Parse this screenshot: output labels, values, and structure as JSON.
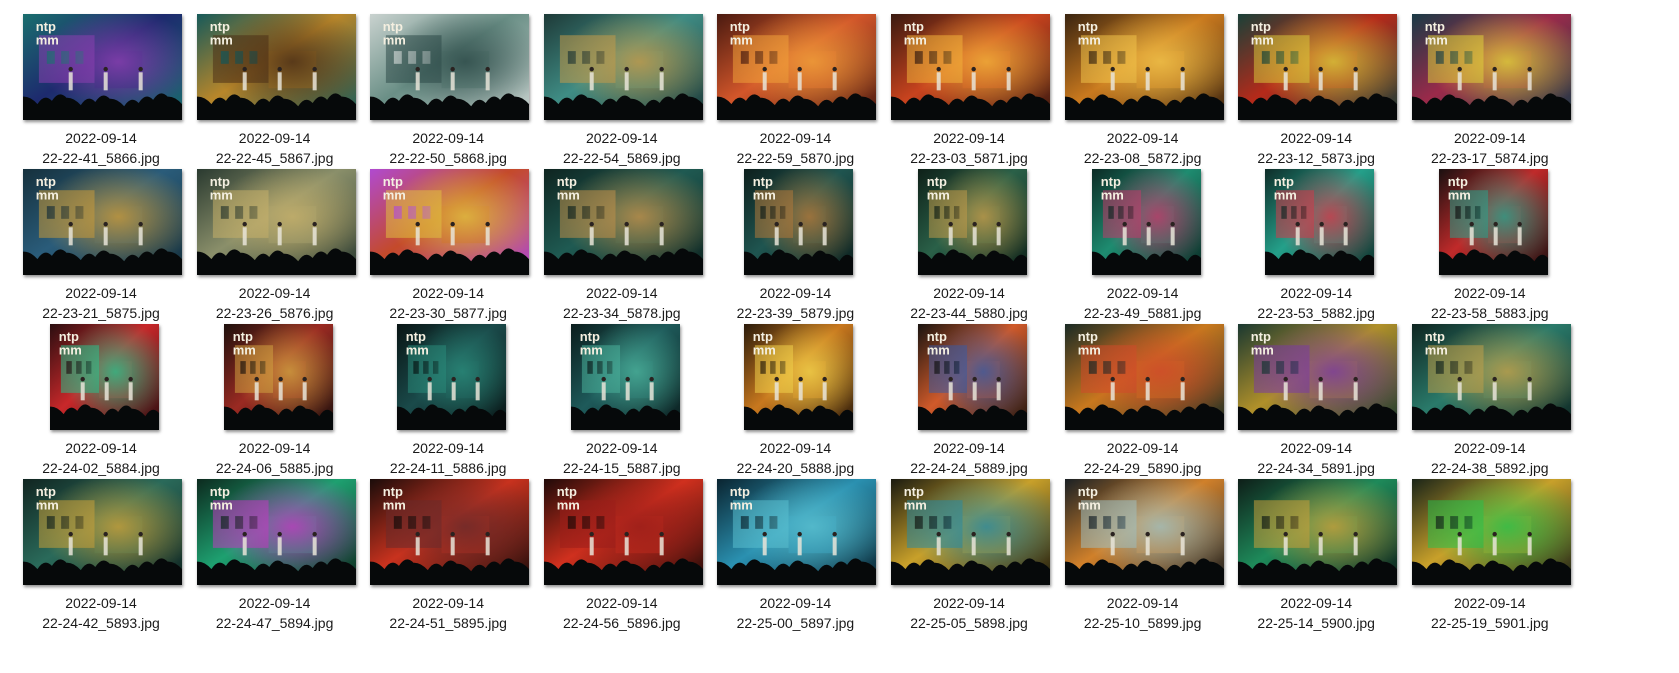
{
  "thumbnails": [
    {
      "date": "2022-09-14",
      "filename": "22-22-41_5866.jpg",
      "orientation": "landscape",
      "palette": [
        "#1d2a6e",
        "#8a3fb0",
        "#1a6e6e"
      ],
      "logo": true
    },
    {
      "date": "2022-09-14",
      "filename": "22-22-45_5867.jpg",
      "orientation": "landscape",
      "palette": [
        "#b8862a",
        "#4a2d16",
        "#175a5a"
      ],
      "logo": true
    },
    {
      "date": "2022-09-14",
      "filename": "22-22-50_5868.jpg",
      "orientation": "landscape",
      "palette": [
        "#6a8f86",
        "#2d4a48",
        "#c9d2cf"
      ],
      "logo": true
    },
    {
      "date": "2022-09-14",
      "filename": "22-22-54_5869.jpg",
      "orientation": "landscape",
      "palette": [
        "#3f8c84",
        "#c29a4a",
        "#1e3a38"
      ],
      "logo": false
    },
    {
      "date": "2022-09-14",
      "filename": "22-22-59_5870.jpg",
      "orientation": "landscape",
      "palette": [
        "#d2562a",
        "#f0a03a",
        "#4a1a10"
      ],
      "logo": true
    },
    {
      "date": "2022-09-14",
      "filename": "22-23-03_5871.jpg",
      "orientation": "landscape",
      "palette": [
        "#c8431e",
        "#f2b23a",
        "#3a1a10"
      ],
      "logo": true
    },
    {
      "date": "2022-09-14",
      "filename": "22-23-08_5872.jpg",
      "orientation": "landscape",
      "palette": [
        "#c9791e",
        "#f0c24a",
        "#3a2410"
      ],
      "logo": true
    },
    {
      "date": "2022-09-14",
      "filename": "22-23-12_5873.jpg",
      "orientation": "landscape",
      "palette": [
        "#b52a1a",
        "#d9c73a",
        "#1a4038"
      ],
      "logo": true
    },
    {
      "date": "2022-09-14",
      "filename": "22-23-17_5874.jpg",
      "orientation": "landscape",
      "palette": [
        "#9a2a4a",
        "#e0d23a",
        "#1a3a46"
      ],
      "logo": true
    },
    {
      "date": "2022-09-14",
      "filename": "22-23-21_5875.jpg",
      "orientation": "landscape",
      "palette": [
        "#2a5c7a",
        "#c99a3a",
        "#15303c"
      ],
      "logo": true
    },
    {
      "date": "2022-09-14",
      "filename": "22-23-26_5876.jpg",
      "orientation": "landscape",
      "palette": [
        "#8a8f6a",
        "#c6b06a",
        "#2a3a30"
      ],
      "logo": true
    },
    {
      "date": "2022-09-14",
      "filename": "22-23-30_5877.jpg",
      "orientation": "landscape",
      "palette": [
        "#c44a2a",
        "#e0c040",
        "#b04ad0"
      ],
      "logo": true
    },
    {
      "date": "2022-09-14",
      "filename": "22-23-34_5878.jpg",
      "orientation": "landscape",
      "palette": [
        "#1f5a52",
        "#c0904a",
        "#0e2420"
      ],
      "logo": true
    },
    {
      "date": "2022-09-14",
      "filename": "22-23-39_5879.jpg",
      "orientation": "portrait",
      "palette": [
        "#1f5550",
        "#b0783a",
        "#0c1e1c"
      ],
      "logo": true
    },
    {
      "date": "2022-09-14",
      "filename": "22-23-44_5880.jpg",
      "orientation": "portrait",
      "palette": [
        "#2a6048",
        "#c09a4a",
        "#0e2018"
      ],
      "logo": true
    },
    {
      "date": "2022-09-14",
      "filename": "22-23-49_5881.jpg",
      "orientation": "portrait",
      "palette": [
        "#1e8c70",
        "#c03a6a",
        "#0b2a24"
      ],
      "logo": true
    },
    {
      "date": "2022-09-14",
      "filename": "22-23-53_5882.jpg",
      "orientation": "portrait",
      "palette": [
        "#24a08a",
        "#d03a4a",
        "#0e2c28"
      ],
      "logo": true
    },
    {
      "date": "2022-09-14",
      "filename": "22-23-58_5883.jpg",
      "orientation": "portrait",
      "palette": [
        "#c02a2a",
        "#2aa08a",
        "#1a1010"
      ],
      "logo": true
    },
    {
      "date": "2022-09-14",
      "filename": "22-24-02_5884.jpg",
      "orientation": "portrait",
      "palette": [
        "#c8282a",
        "#2ac08a",
        "#2a0e10"
      ],
      "logo": true
    },
    {
      "date": "2022-09-14",
      "filename": "22-24-06_5885.jpg",
      "orientation": "portrait",
      "palette": [
        "#9a2a22",
        "#d0a040",
        "#1e100c"
      ],
      "logo": true
    },
    {
      "date": "2022-09-14",
      "filename": "22-24-11_5886.jpg",
      "orientation": "portrait",
      "palette": [
        "#1a4a4a",
        "#2a8a7a",
        "#081414"
      ],
      "logo": true
    },
    {
      "date": "2022-09-14",
      "filename": "22-24-15_5887.jpg",
      "orientation": "portrait",
      "palette": [
        "#1e5a5a",
        "#4ab09a",
        "#0a1c1c"
      ],
      "logo": true
    },
    {
      "date": "2022-09-14",
      "filename": "22-24-20_5888.jpg",
      "orientation": "portrait",
      "palette": [
        "#c8781e",
        "#f0d04a",
        "#2a1a0a"
      ],
      "logo": true
    },
    {
      "date": "2022-09-14",
      "filename": "22-24-24_5889.jpg",
      "orientation": "portrait",
      "palette": [
        "#d05a2a",
        "#3a5aa0",
        "#1a1410"
      ],
      "logo": true
    },
    {
      "date": "2022-09-14",
      "filename": "22-24-29_5890.jpg",
      "orientation": "landscape",
      "palette": [
        "#c8781e",
        "#d04a2a",
        "#1a2a24"
      ],
      "logo": true
    },
    {
      "date": "2022-09-14",
      "filename": "22-24-34_5891.jpg",
      "orientation": "landscape",
      "palette": [
        "#b0902a",
        "#7a3aa0",
        "#1a3830"
      ],
      "logo": true
    },
    {
      "date": "2022-09-14",
      "filename": "22-24-38_5892.jpg",
      "orientation": "landscape",
      "palette": [
        "#2a7a6a",
        "#c0a04a",
        "#0e2420"
      ],
      "logo": true
    },
    {
      "date": "2022-09-14",
      "filename": "22-24-42_5893.jpg",
      "orientation": "landscape",
      "palette": [
        "#2a6a5a",
        "#c8a03a",
        "#102420"
      ],
      "logo": true
    },
    {
      "date": "2022-09-14",
      "filename": "22-24-47_5894.jpg",
      "orientation": "landscape",
      "palette": [
        "#1ea070",
        "#c03ac0",
        "#0c2a1e"
      ],
      "logo": true
    },
    {
      "date": "2022-09-14",
      "filename": "22-24-51_5895.jpg",
      "orientation": "landscape",
      "palette": [
        "#c8321e",
        "#6a2a2a",
        "#1a0c0a"
      ],
      "logo": true
    },
    {
      "date": "2022-09-14",
      "filename": "22-24-56_5896.jpg",
      "orientation": "landscape",
      "palette": [
        "#d0301e",
        "#9a1e1a",
        "#200a08"
      ],
      "logo": true
    },
    {
      "date": "2022-09-14",
      "filename": "22-25-00_5897.jpg",
      "orientation": "landscape",
      "palette": [
        "#2a90b0",
        "#5ac0d0",
        "#0a2430"
      ],
      "logo": true
    },
    {
      "date": "2022-09-14",
      "filename": "22-25-05_5898.jpg",
      "orientation": "landscape",
      "palette": [
        "#c8a02a",
        "#2a8aa0",
        "#1a1a10"
      ],
      "logo": true
    },
    {
      "date": "2022-09-14",
      "filename": "22-25-10_5899.jpg",
      "orientation": "landscape",
      "palette": [
        "#d0802a",
        "#a0c0c0",
        "#1a2024"
      ],
      "logo": true
    },
    {
      "date": "2022-09-14",
      "filename": "22-25-14_5900.jpg",
      "orientation": "landscape",
      "palette": [
        "#1e8a5a",
        "#c8a03a",
        "#0e1e18"
      ],
      "logo": false
    },
    {
      "date": "2022-09-14",
      "filename": "22-25-19_5901.jpg",
      "orientation": "landscape",
      "palette": [
        "#c8a02a",
        "#2ac04a",
        "#1a2418"
      ],
      "logo": false
    }
  ]
}
